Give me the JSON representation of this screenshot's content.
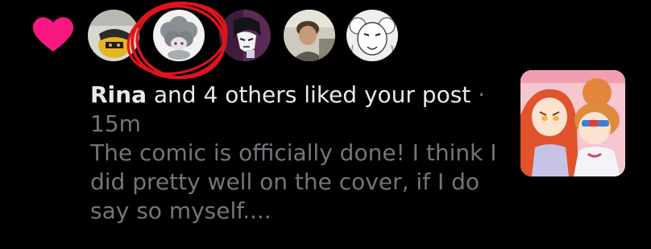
{
  "notification": {
    "type_icon": "heart-icon",
    "heart_color": "#f91880",
    "actor_name": "Rina",
    "action_text": " and 4 others liked your post",
    "separator": " ·",
    "timestamp": "15m",
    "post_preview": "The comic is officially done! I think I did pretty well on the cover, if I do say so myself....",
    "avatars": [
      {
        "icon": "yellow-character-avatar"
      },
      {
        "icon": "gray-cloud-hair-avatar"
      },
      {
        "icon": "dark-haired-sketch-avatar"
      },
      {
        "icon": "photo-person-avatar"
      },
      {
        "icon": "white-creature-avatar"
      }
    ],
    "annotation": {
      "icon": "red-scribble-circle",
      "color": "#e0141e"
    },
    "thumbnail": {
      "icon": "comic-cover-thumbnail"
    }
  }
}
